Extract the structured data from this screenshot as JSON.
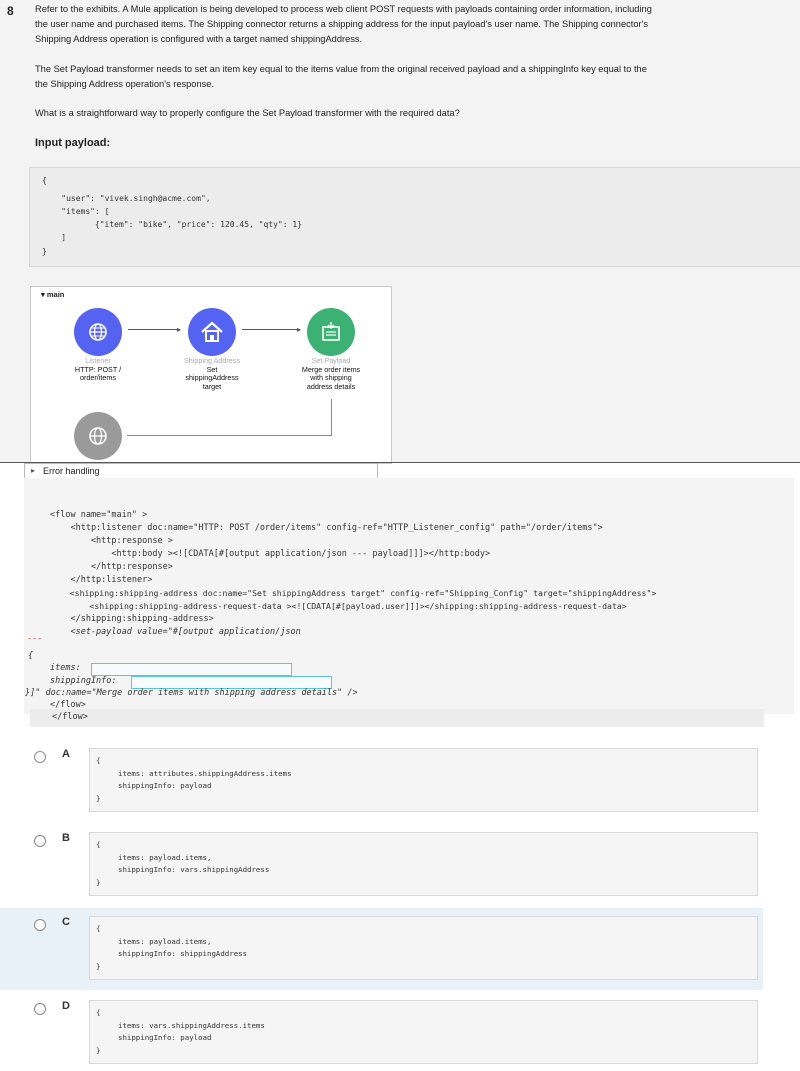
{
  "question": {
    "number": "8",
    "p1_lines": [
      "Refer to the exhibits. A Mule application is being developed to process web client POST requests with payloads containing order information, including",
      "the user name and purchased items. The Shipping connector returns a shipping address for the input payload's user name. The Shipping connector's",
      "Shipping Address operation is configured with a target named shippingAddress."
    ],
    "p2_lines": [
      "The Set Payload transformer needs to set an item key equal to the items value from the original received payload and a shippingInfo key equal to the",
      "the Shipping Address operation's response."
    ],
    "p3": "What is a straightforward way to properly configure the Set Payload transformer with the required data?",
    "input_title": "Input payload:"
  },
  "payload_lines": [
    "{",
    "    \"user\": \"vivek.singh@acme.com\",",
    "    \"items\": [",
    "      {\"item\": \"bike\", \"price\": 120.45, \"qty\": 1}",
    "    ]",
    "}"
  ],
  "diagram": {
    "flow_name": "main",
    "listener": {
      "type": "Listener",
      "l1": "HTTP: POST /",
      "l2": "order/items"
    },
    "shipping": {
      "type": "Shipping Address",
      "l1": "Set",
      "l2": "shippingAddress",
      "l3": "target"
    },
    "setpayload": {
      "type": "Set Payload",
      "l1": "Merge order items",
      "l2": "with shipping",
      "l3": "address details"
    },
    "error_handling": "Error handling"
  },
  "xml_lines": [
    "<flow name=\"main\" >",
    "    <http:listener doc:name=\"HTTP: POST /order/items\" config-ref=\"HTTP_Listener_config\" path=\"/order/items\">",
    "        <http:response >",
    "            <http:body ><![CDATA[#[output application/json --- payload]]]></http:body>",
    "        </http:response>",
    "    </http:listener>",
    "    <shipping:shipping-address doc:name=\"Set shippingAddress target\" config-ref=\"Shipping_Config\" target=\"shippingAddress\">",
    "        <shipping:shipping-address-request-data ><![CDATA[#[payload.user]]]></shipping:shipping-address-request-data>",
    "    </shipping:shipping-address>",
    "    <set-payload value=\"#[output application/json"
  ],
  "xml_sep": "---",
  "xml_brace": "{",
  "xml_items": "items:",
  "xml_shipping": "shippingInfo:",
  "xml_close": "}]\" doc:name=\"Merge order items with shipping address details\" />",
  "xml_flow_close1": "</flow>",
  "xml_flow_close2": "</flow>",
  "options": [
    {
      "letter": "A",
      "open": "{",
      "line1": "items: attributes.shippingAddress.items",
      "line2": "shippingInfo: payload",
      "close": "}"
    },
    {
      "letter": "B",
      "open": "{",
      "line1": "items: payload.items,",
      "line2": "shippingInfo: vars.shippingAddress",
      "close": "}"
    },
    {
      "letter": "C",
      "open": "{",
      "line1": "items: payload.items,",
      "line2": "shippingInfo: shippingAddress",
      "close": "}"
    },
    {
      "letter": "D",
      "open": "{",
      "line1": "items: vars.shippingAddress.items",
      "line2": "shippingInfo: payload",
      "close": "}"
    }
  ],
  "colors": {
    "circle_blue": "#5463f2",
    "circle_green": "#3bb273",
    "circle_gray": "#9a9a9a",
    "blank_border": "#5cc5d6"
  },
  "icons": {
    "listener": "globe-icon",
    "shipping": "house-icon",
    "setpayload": "set-payload-icon"
  }
}
